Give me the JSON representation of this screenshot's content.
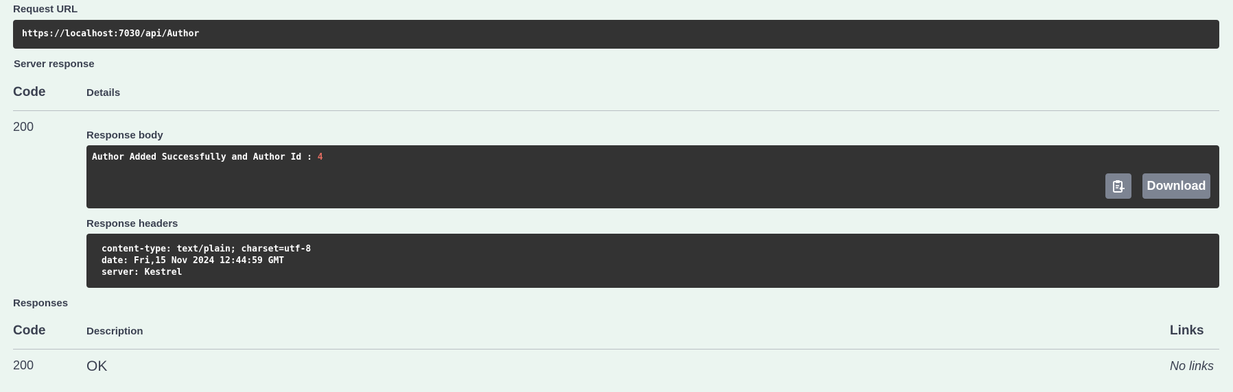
{
  "request_url": {
    "label": "Request URL",
    "value": "https://localhost:7030/api/Author"
  },
  "server_response": {
    "label": "Server response",
    "table": {
      "header_code": "Code",
      "header_details": "Details"
    },
    "row": {
      "code": "200",
      "response_body": {
        "label": "Response body",
        "text": "Author Added Successfully and Author Id :",
        "id_value": "4",
        "copy_icon": "clipboard-icon",
        "download_label": "Download"
      },
      "response_headers": {
        "label": "Response headers",
        "lines": [
          "content-type: text/plain; charset=utf-8",
          "date: Fri,15 Nov 2024 12:44:59 GMT",
          "server: Kestrel"
        ]
      }
    }
  },
  "responses": {
    "label": "Responses",
    "table": {
      "header_code": "Code",
      "header_description": "Description",
      "header_links": "Links"
    },
    "rows": [
      {
        "code": "200",
        "description": "OK",
        "links": "No links"
      }
    ]
  },
  "colors": {
    "background": "#ebf5f0",
    "code_block": "#333333",
    "button_gray": "#7d8492",
    "number_highlight": "#e06c60",
    "text": "#3b4151"
  }
}
